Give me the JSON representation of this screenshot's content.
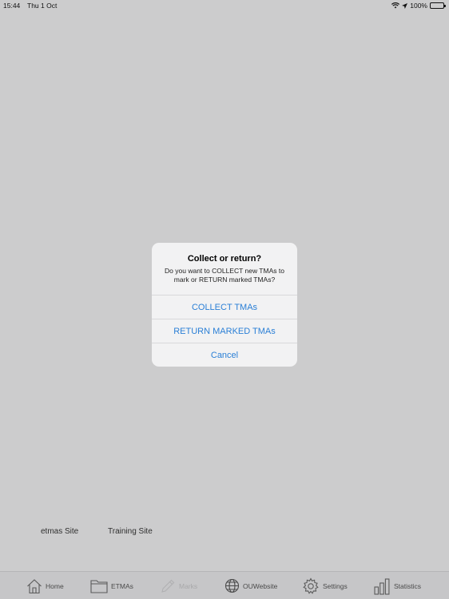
{
  "status_bar": {
    "time": "15:44",
    "date": "Thu 1 Oct",
    "battery": "100%"
  },
  "footer_links": {
    "etmas_site": "etmas Site",
    "training_site": "Training Site"
  },
  "alert": {
    "title": "Collect or return?",
    "message": "Do you want to COLLECT new TMAs to mark or RETURN marked TMAs?",
    "actions": {
      "collect": "COLLECT TMAs",
      "return": "RETURN MARKED TMAs",
      "cancel": "Cancel"
    }
  },
  "tab_bar": {
    "items": [
      {
        "label": "Home",
        "icon": "home-icon"
      },
      {
        "label": "ETMAs",
        "icon": "folder-icon"
      },
      {
        "label": "Marks",
        "icon": "pencil-icon",
        "disabled": true
      },
      {
        "label": "OUWebsite",
        "icon": "globe-icon"
      },
      {
        "label": "Settings",
        "icon": "gear-icon"
      },
      {
        "label": "Statistics",
        "icon": "bar-chart-icon"
      }
    ]
  },
  "colors": {
    "background": "#cccccd",
    "accent": "#2a7fd6",
    "alert_background": "#f2f2f3"
  }
}
